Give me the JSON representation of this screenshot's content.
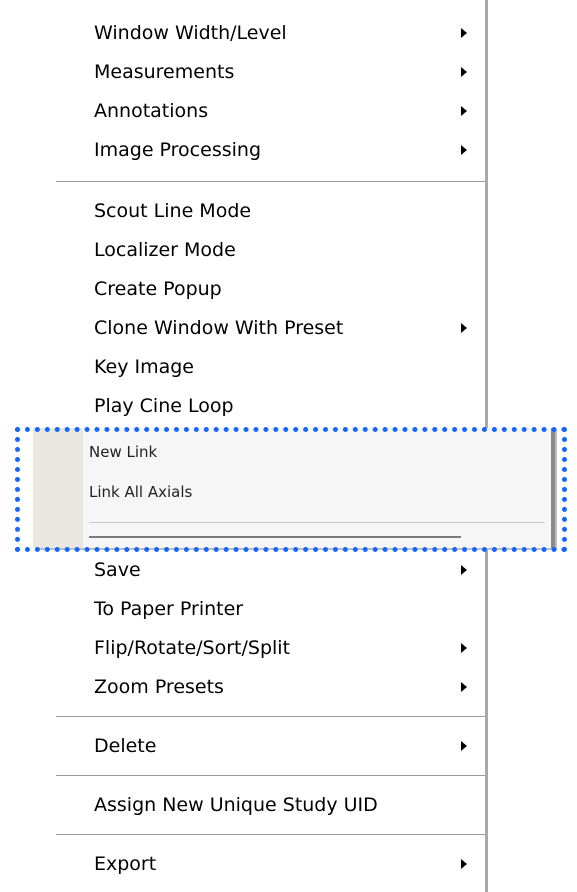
{
  "menu": {
    "groups": [
      [
        {
          "label": "Window Width/Level",
          "submenu": true
        },
        {
          "label": "Measurements",
          "submenu": true
        },
        {
          "label": "Annotations",
          "submenu": true
        },
        {
          "label": "Image Processing",
          "submenu": true
        }
      ],
      [
        {
          "label": "Scout Line Mode",
          "submenu": false
        },
        {
          "label": "Localizer Mode",
          "submenu": false
        },
        {
          "label": "Create Popup",
          "submenu": false
        },
        {
          "label": "Clone Window With Preset",
          "submenu": true
        },
        {
          "label": "Key Image",
          "submenu": false
        },
        {
          "label": "Play Cine Loop",
          "submenu": false
        }
      ],
      [
        {
          "label": "Save",
          "submenu": true
        },
        {
          "label": "To Paper Printer",
          "submenu": false
        },
        {
          "label": "Flip/Rotate/Sort/Split",
          "submenu": true
        },
        {
          "label": "Zoom Presets",
          "submenu": true
        }
      ],
      [
        {
          "label": "Delete",
          "submenu": true
        }
      ],
      [
        {
          "label": "Assign New Unique Study UID",
          "submenu": false
        }
      ],
      [
        {
          "label": "Export",
          "submenu": true
        }
      ]
    ]
  },
  "link_submenu": {
    "items": [
      {
        "label": "New Link"
      },
      {
        "label": "Link All Axials"
      }
    ]
  },
  "colors": {
    "highlight_border": "#1565ff",
    "menu_background": "#ffffff",
    "gutter": "#e9e7df"
  }
}
